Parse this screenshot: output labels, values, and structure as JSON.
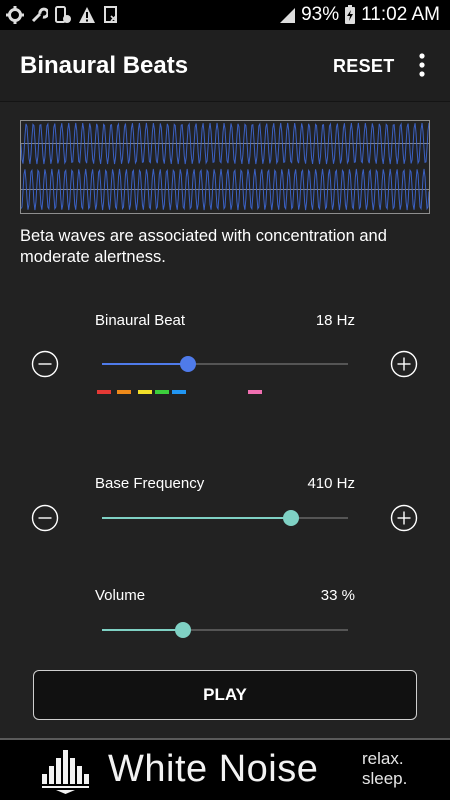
{
  "status_bar": {
    "battery": "93%",
    "time": "11:02 AM",
    "icons": [
      "settings-icon",
      "wrench-icon",
      "phone-clock-icon",
      "warning-icon",
      "document-icon",
      "signal-icon",
      "battery-charging-icon"
    ]
  },
  "app_bar": {
    "title": "Binaural Beats",
    "reset_label": "RESET",
    "menu_icon": "more-vert-icon"
  },
  "description": "Beta waves are associated with concentration and moderate alertness.",
  "sliders": [
    {
      "label": "Binaural Beat",
      "value_text": "18 Hz",
      "fraction": 0.35,
      "accent": "#4f7bea"
    },
    {
      "label": "Base Frequency",
      "value_text": "410 Hz",
      "fraction": 0.77,
      "accent": "#7fd1c4"
    },
    {
      "label": "Volume",
      "value_text": "33 %",
      "fraction": 0.33,
      "accent": "#7fd1c4"
    }
  ],
  "band_colors": [
    "#e53935",
    "#ef8a1a",
    "#f2e02a",
    "#3ccf3c",
    "#2196f3",
    "#f06fb1"
  ],
  "play_label": "PLAY",
  "ad": {
    "brand": "White Noise",
    "tagline_line1": "relax.",
    "tagline_line2": "sleep."
  }
}
